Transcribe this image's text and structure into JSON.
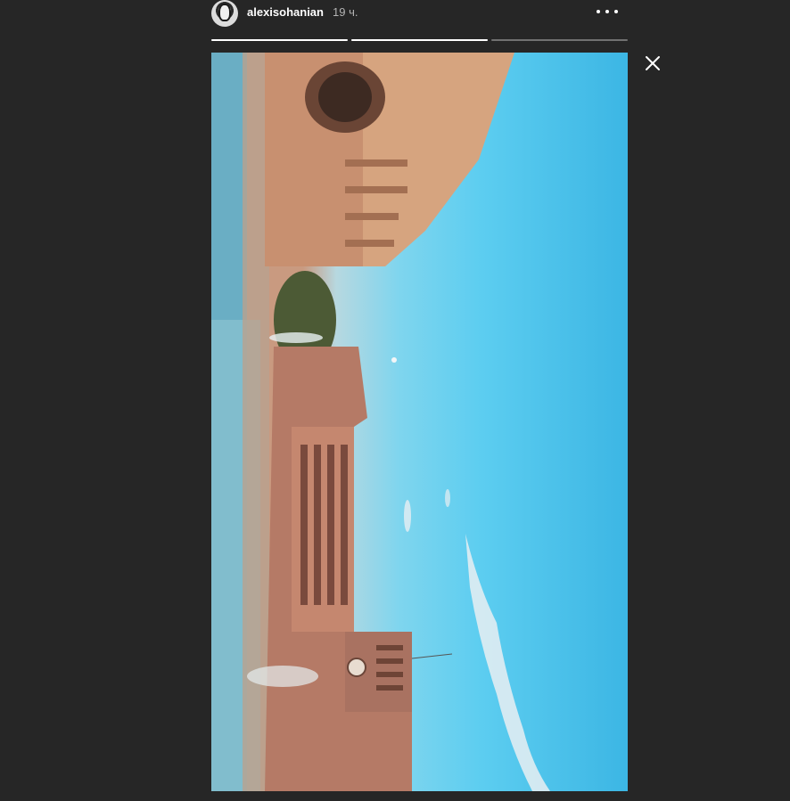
{
  "story": {
    "username": "alexisohanian",
    "time_ago": "19 ч.",
    "progress": [
      {
        "state": "done"
      },
      {
        "state": "active",
        "fraction": 1.0
      },
      {
        "state": "pending"
      },
      {
        "state": "pending"
      }
    ],
    "icons": {
      "more": "more-options-icon",
      "close": "close-icon",
      "avatar": "user-avatar"
    }
  },
  "colors": {
    "background": "#262626",
    "text": "#ffffff",
    "muted": "#b3b3b3",
    "sky": "#3cb6e4"
  }
}
